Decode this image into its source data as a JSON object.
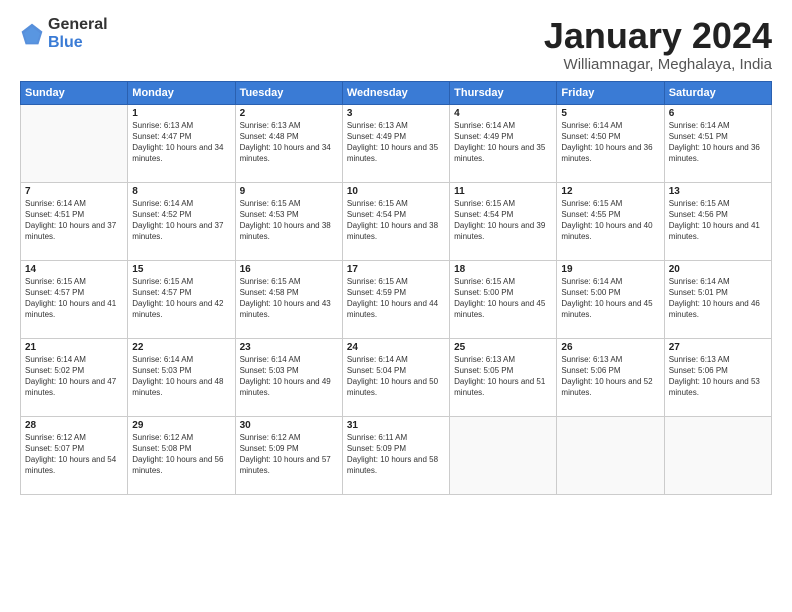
{
  "logo": {
    "general": "General",
    "blue": "Blue"
  },
  "header": {
    "title": "January 2024",
    "subtitle": "Williamnagar, Meghalaya, India"
  },
  "weekdays": [
    "Sunday",
    "Monday",
    "Tuesday",
    "Wednesday",
    "Thursday",
    "Friday",
    "Saturday"
  ],
  "weeks": [
    [
      {
        "day": "",
        "sunrise": "",
        "sunset": "",
        "daylight": ""
      },
      {
        "day": "1",
        "sunrise": "Sunrise: 6:13 AM",
        "sunset": "Sunset: 4:47 PM",
        "daylight": "Daylight: 10 hours and 34 minutes."
      },
      {
        "day": "2",
        "sunrise": "Sunrise: 6:13 AM",
        "sunset": "Sunset: 4:48 PM",
        "daylight": "Daylight: 10 hours and 34 minutes."
      },
      {
        "day": "3",
        "sunrise": "Sunrise: 6:13 AM",
        "sunset": "Sunset: 4:49 PM",
        "daylight": "Daylight: 10 hours and 35 minutes."
      },
      {
        "day": "4",
        "sunrise": "Sunrise: 6:14 AM",
        "sunset": "Sunset: 4:49 PM",
        "daylight": "Daylight: 10 hours and 35 minutes."
      },
      {
        "day": "5",
        "sunrise": "Sunrise: 6:14 AM",
        "sunset": "Sunset: 4:50 PM",
        "daylight": "Daylight: 10 hours and 36 minutes."
      },
      {
        "day": "6",
        "sunrise": "Sunrise: 6:14 AM",
        "sunset": "Sunset: 4:51 PM",
        "daylight": "Daylight: 10 hours and 36 minutes."
      }
    ],
    [
      {
        "day": "7",
        "sunrise": "Sunrise: 6:14 AM",
        "sunset": "Sunset: 4:51 PM",
        "daylight": "Daylight: 10 hours and 37 minutes."
      },
      {
        "day": "8",
        "sunrise": "Sunrise: 6:14 AM",
        "sunset": "Sunset: 4:52 PM",
        "daylight": "Daylight: 10 hours and 37 minutes."
      },
      {
        "day": "9",
        "sunrise": "Sunrise: 6:15 AM",
        "sunset": "Sunset: 4:53 PM",
        "daylight": "Daylight: 10 hours and 38 minutes."
      },
      {
        "day": "10",
        "sunrise": "Sunrise: 6:15 AM",
        "sunset": "Sunset: 4:54 PM",
        "daylight": "Daylight: 10 hours and 38 minutes."
      },
      {
        "day": "11",
        "sunrise": "Sunrise: 6:15 AM",
        "sunset": "Sunset: 4:54 PM",
        "daylight": "Daylight: 10 hours and 39 minutes."
      },
      {
        "day": "12",
        "sunrise": "Sunrise: 6:15 AM",
        "sunset": "Sunset: 4:55 PM",
        "daylight": "Daylight: 10 hours and 40 minutes."
      },
      {
        "day": "13",
        "sunrise": "Sunrise: 6:15 AM",
        "sunset": "Sunset: 4:56 PM",
        "daylight": "Daylight: 10 hours and 41 minutes."
      }
    ],
    [
      {
        "day": "14",
        "sunrise": "Sunrise: 6:15 AM",
        "sunset": "Sunset: 4:57 PM",
        "daylight": "Daylight: 10 hours and 41 minutes."
      },
      {
        "day": "15",
        "sunrise": "Sunrise: 6:15 AM",
        "sunset": "Sunset: 4:57 PM",
        "daylight": "Daylight: 10 hours and 42 minutes."
      },
      {
        "day": "16",
        "sunrise": "Sunrise: 6:15 AM",
        "sunset": "Sunset: 4:58 PM",
        "daylight": "Daylight: 10 hours and 43 minutes."
      },
      {
        "day": "17",
        "sunrise": "Sunrise: 6:15 AM",
        "sunset": "Sunset: 4:59 PM",
        "daylight": "Daylight: 10 hours and 44 minutes."
      },
      {
        "day": "18",
        "sunrise": "Sunrise: 6:15 AM",
        "sunset": "Sunset: 5:00 PM",
        "daylight": "Daylight: 10 hours and 45 minutes."
      },
      {
        "day": "19",
        "sunrise": "Sunrise: 6:14 AM",
        "sunset": "Sunset: 5:00 PM",
        "daylight": "Daylight: 10 hours and 45 minutes."
      },
      {
        "day": "20",
        "sunrise": "Sunrise: 6:14 AM",
        "sunset": "Sunset: 5:01 PM",
        "daylight": "Daylight: 10 hours and 46 minutes."
      }
    ],
    [
      {
        "day": "21",
        "sunrise": "Sunrise: 6:14 AM",
        "sunset": "Sunset: 5:02 PM",
        "daylight": "Daylight: 10 hours and 47 minutes."
      },
      {
        "day": "22",
        "sunrise": "Sunrise: 6:14 AM",
        "sunset": "Sunset: 5:03 PM",
        "daylight": "Daylight: 10 hours and 48 minutes."
      },
      {
        "day": "23",
        "sunrise": "Sunrise: 6:14 AM",
        "sunset": "Sunset: 5:03 PM",
        "daylight": "Daylight: 10 hours and 49 minutes."
      },
      {
        "day": "24",
        "sunrise": "Sunrise: 6:14 AM",
        "sunset": "Sunset: 5:04 PM",
        "daylight": "Daylight: 10 hours and 50 minutes."
      },
      {
        "day": "25",
        "sunrise": "Sunrise: 6:13 AM",
        "sunset": "Sunset: 5:05 PM",
        "daylight": "Daylight: 10 hours and 51 minutes."
      },
      {
        "day": "26",
        "sunrise": "Sunrise: 6:13 AM",
        "sunset": "Sunset: 5:06 PM",
        "daylight": "Daylight: 10 hours and 52 minutes."
      },
      {
        "day": "27",
        "sunrise": "Sunrise: 6:13 AM",
        "sunset": "Sunset: 5:06 PM",
        "daylight": "Daylight: 10 hours and 53 minutes."
      }
    ],
    [
      {
        "day": "28",
        "sunrise": "Sunrise: 6:12 AM",
        "sunset": "Sunset: 5:07 PM",
        "daylight": "Daylight: 10 hours and 54 minutes."
      },
      {
        "day": "29",
        "sunrise": "Sunrise: 6:12 AM",
        "sunset": "Sunset: 5:08 PM",
        "daylight": "Daylight: 10 hours and 56 minutes."
      },
      {
        "day": "30",
        "sunrise": "Sunrise: 6:12 AM",
        "sunset": "Sunset: 5:09 PM",
        "daylight": "Daylight: 10 hours and 57 minutes."
      },
      {
        "day": "31",
        "sunrise": "Sunrise: 6:11 AM",
        "sunset": "Sunset: 5:09 PM",
        "daylight": "Daylight: 10 hours and 58 minutes."
      },
      {
        "day": "",
        "sunrise": "",
        "sunset": "",
        "daylight": ""
      },
      {
        "day": "",
        "sunrise": "",
        "sunset": "",
        "daylight": ""
      },
      {
        "day": "",
        "sunrise": "",
        "sunset": "",
        "daylight": ""
      }
    ]
  ]
}
